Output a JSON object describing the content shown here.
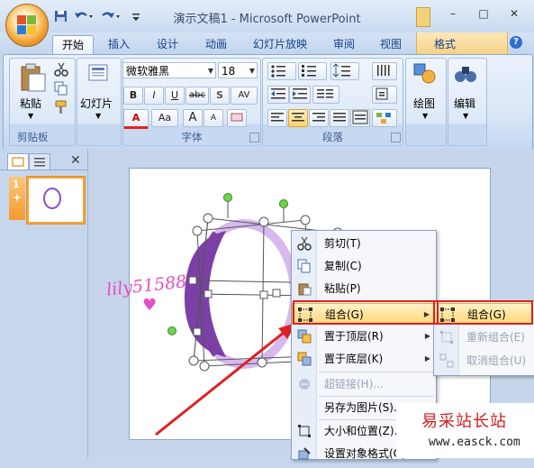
{
  "window": {
    "title": "演示文稿1 - Microsoft PowerPoint",
    "minimize": "–",
    "maximize": "□",
    "close": "✕"
  },
  "tabs": [
    "开始",
    "插入",
    "设计",
    "动画",
    "幻灯片放映",
    "审阅",
    "视图",
    "格式"
  ],
  "help_icon": "?",
  "ribbon": {
    "clipboard": {
      "paste": "粘贴",
      "label": "剪贴板"
    },
    "slides": {
      "slide": "幻灯片",
      "label": ""
    },
    "font": {
      "family": "微软雅黑",
      "size": "18",
      "label": "字体",
      "bold": "B",
      "italic": "I",
      "underline": "U",
      "strike": "abc",
      "shadow": "S",
      "spacing": "AV",
      "color": "A",
      "case": "Aa",
      "grow": "A",
      "shrink": "A"
    },
    "paragraph": {
      "label": "段落"
    },
    "drawing": {
      "label": "绘图"
    },
    "editing": {
      "label": "编辑"
    }
  },
  "panel": {
    "slide_number": "1"
  },
  "slide": {
    "annotation": "lily51588"
  },
  "context_menu": [
    {
      "icon": "scissors-icon",
      "label": "剪切(T)",
      "enabled": true
    },
    {
      "icon": "copy-icon",
      "label": "复制(C)",
      "enabled": true
    },
    {
      "icon": "paste-icon",
      "label": "粘贴(P)",
      "enabled": true
    },
    {
      "icon": "group-icon",
      "label": "组合(G)",
      "enabled": true,
      "submenu": true,
      "highlighted": true
    },
    {
      "icon": "bring-front-icon",
      "label": "置于顶层(R)",
      "enabled": true,
      "submenu": true
    },
    {
      "icon": "send-back-icon",
      "label": "置于底层(K)",
      "enabled": true,
      "submenu": true
    },
    {
      "icon": "hyperlink-icon",
      "label": "超链接(H)...",
      "enabled": false
    },
    {
      "icon": "save-picture-icon",
      "label": "另存为图片(S)...",
      "enabled": true
    },
    {
      "icon": "size-position-icon",
      "label": "大小和位置(Z)...",
      "enabled": true
    },
    {
      "icon": "format-shape-icon",
      "label": "设置对象格式(O)...",
      "enabled": true
    }
  ],
  "submenu": [
    {
      "icon": "group-icon",
      "label": "组合(G)",
      "enabled": true,
      "highlighted": true
    },
    {
      "icon": "regroup-icon",
      "label": "重新组合(E)",
      "enabled": false
    },
    {
      "icon": "ungroup-icon",
      "label": "取消组合(U)",
      "enabled": false
    }
  ],
  "watermark": {
    "title": "易采站长站",
    "url": "www.easck.com"
  },
  "colors": {
    "accent": "#f7a33b",
    "highlight": "#ffd978",
    "purple": "#7b3fa6",
    "light_purple": "#d7b9ee",
    "red": "#e02020"
  }
}
